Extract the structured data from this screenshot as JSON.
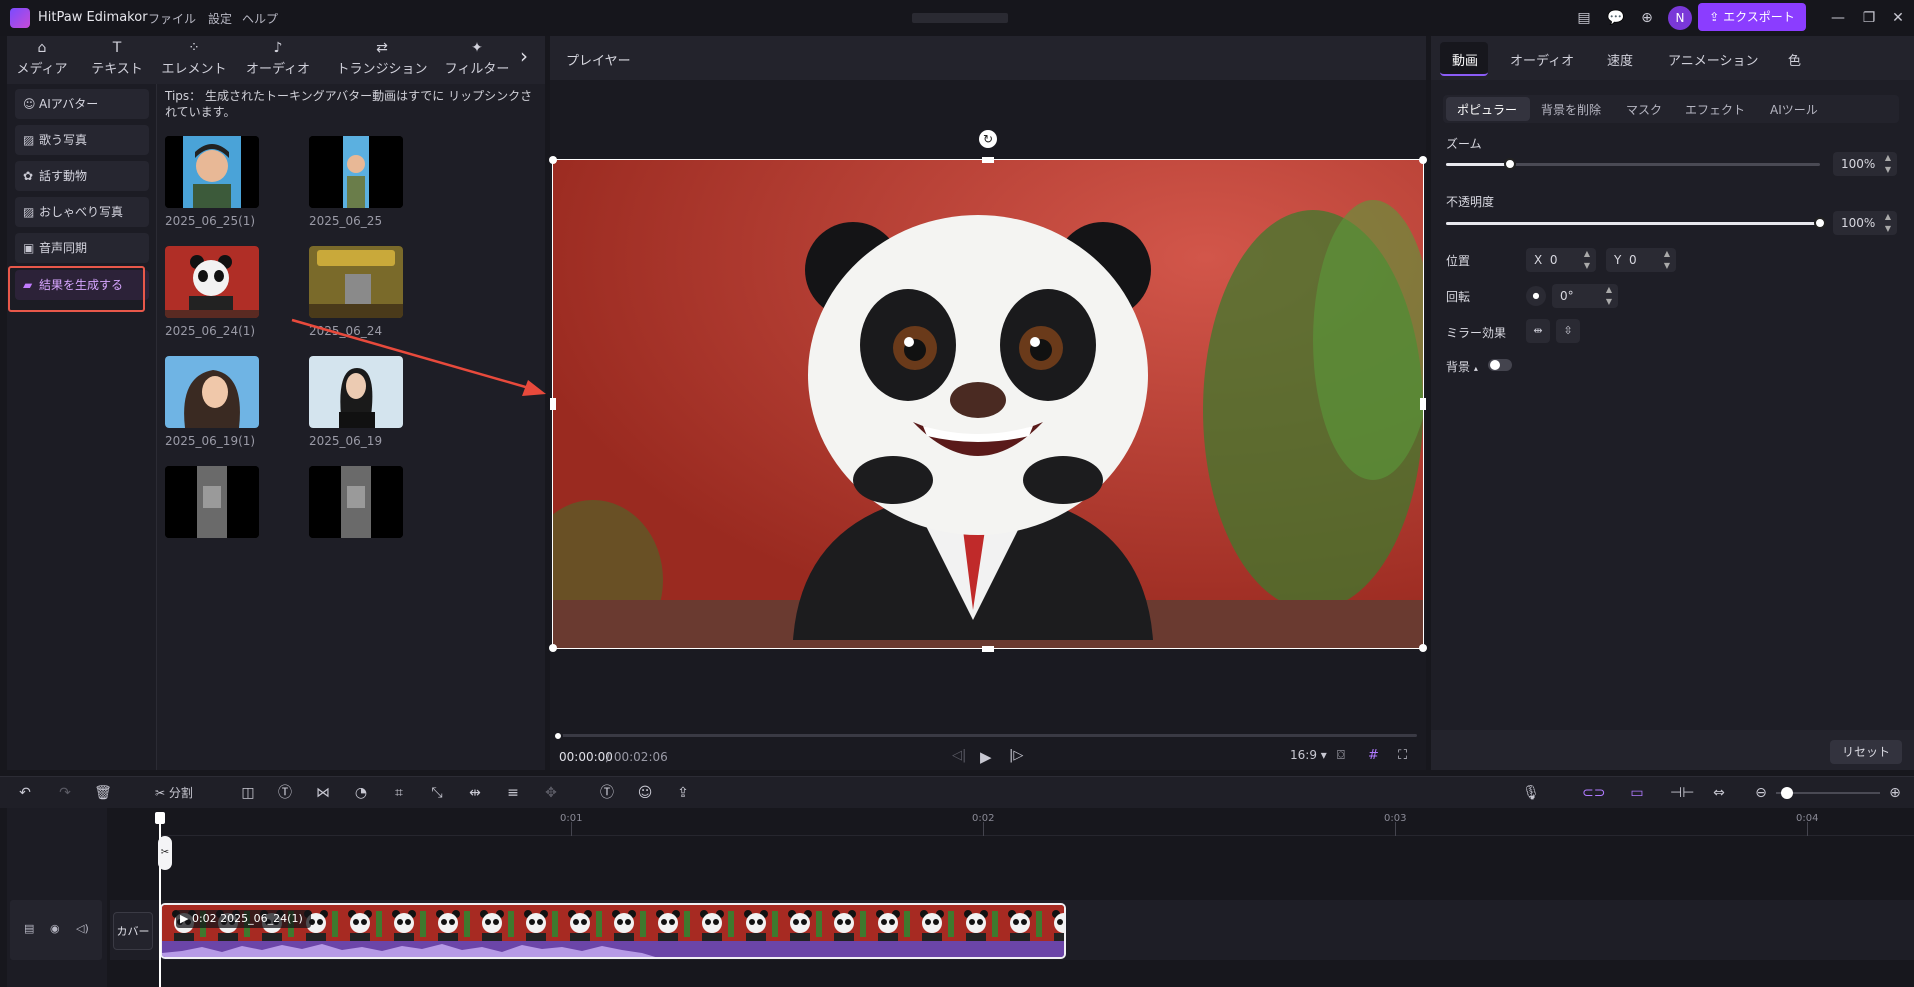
{
  "app": {
    "name": "HitPaw Edimakor",
    "menu": [
      "ファイル",
      "設定",
      "ヘルプ"
    ],
    "avatar_letter": "N",
    "export_label": "エクスポート",
    "accent": "#8b3dff"
  },
  "left_tabs": [
    {
      "label": "メディア",
      "icon": "media-icon"
    },
    {
      "label": "テキスト",
      "icon": "text-icon"
    },
    {
      "label": "エレメント",
      "icon": "element-icon"
    },
    {
      "label": "オーディオ",
      "icon": "audio-icon"
    },
    {
      "label": "トランジション",
      "icon": "transition-icon"
    },
    {
      "label": "フィルター",
      "icon": "filter-icon"
    }
  ],
  "side_nav": [
    {
      "label": "AIアバター",
      "icon": "ai-avatar-icon"
    },
    {
      "label": "歌う写真",
      "icon": "singing-photo-icon"
    },
    {
      "label": "話す動物",
      "icon": "talking-animal-icon"
    },
    {
      "label": "おしゃべり写真",
      "icon": "talking-photo-icon"
    },
    {
      "label": "音声同期",
      "icon": "audio-sync-icon"
    },
    {
      "label": "結果を生成する",
      "icon": "folder-icon",
      "active": true
    }
  ],
  "tips": "Tips：  生成されたトーキングアバター動画はすでに リップシンクされています。",
  "thumbnails": [
    {
      "label": "2025_06_25(1)",
      "kind": "boy"
    },
    {
      "label": "2025_06_25",
      "kind": "boy-small"
    },
    {
      "label": "2025_06_24(1)",
      "kind": "panda"
    },
    {
      "label": "2025_06_24",
      "kind": "sign"
    },
    {
      "label": "2025_06_19(1)",
      "kind": "woman-blue"
    },
    {
      "label": "2025_06_19",
      "kind": "woman-light"
    },
    {
      "label": "",
      "kind": "cat"
    },
    {
      "label": "",
      "kind": "cat"
    }
  ],
  "player": {
    "title": "プレイヤー",
    "time_current": "00:00:00",
    "time_total": "/ 00:02:06",
    "aspect": "16:9"
  },
  "right_tabs": [
    "動画",
    "オーディオ",
    "速度",
    "アニメーション",
    "色"
  ],
  "sub_tabs": [
    "ポピュラー",
    "背景を削除",
    "マスク",
    "エフェクト",
    "AIツール"
  ],
  "props": {
    "zoom_label": "ズーム",
    "zoom_value": "100%",
    "zoom_fraction": 0.17,
    "opacity_label": "不透明度",
    "opacity_value": "100%",
    "opacity_fraction": 1.0,
    "position_label": "位置",
    "x_label": "X",
    "x_value": "0",
    "y_label": "Y",
    "y_value": "0",
    "rotation_label": "回転",
    "rotation_value": "0°",
    "mirror_label": "ミラー効果",
    "background_label": "背景",
    "reset_label": "リセット"
  },
  "toolbar": {
    "split_label": "分割"
  },
  "timeline": {
    "ruler": [
      "0:01",
      "0:02",
      "0:03",
      "0:04"
    ],
    "cover_label": "カバー",
    "clip_label": "0:02 2025_06_24(1)"
  }
}
